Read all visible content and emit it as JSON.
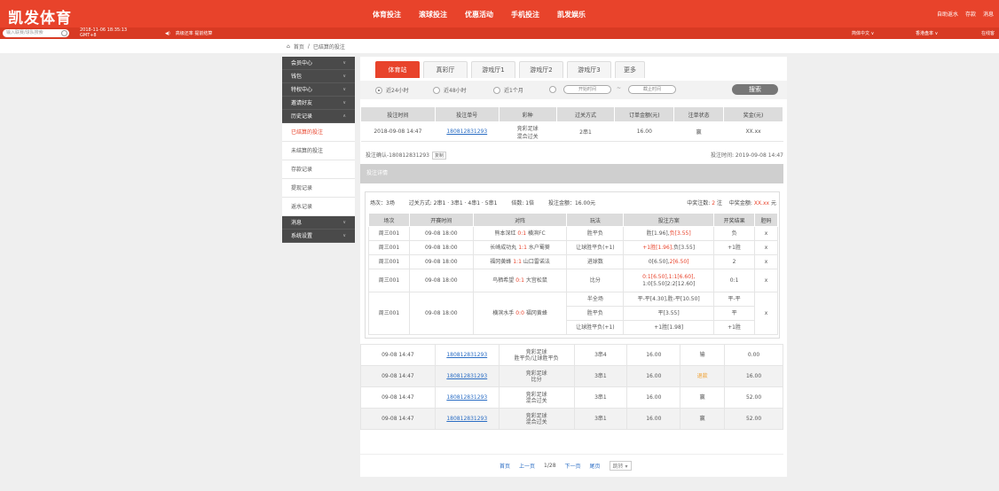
{
  "header": {
    "logo": "凯发体育",
    "nav": [
      "体育投注",
      "滚球投注",
      "优惠活动",
      "手机投注",
      "凯发娱乐"
    ],
    "right": [
      "自助返水",
      "存款",
      "消息"
    ]
  },
  "subbar": {
    "search_placeholder": "输入联赛/球队搜索",
    "datetime_line1": "2018-11-06 18:35:13",
    "datetime_line2": "GMT+8",
    "notice": "高级还率 提前结算",
    "lang": "简体中文 ∨",
    "odds": "香港盘率 ∨",
    "online": "在线客"
  },
  "breadcrumb": {
    "home": "首页",
    "sep": "/",
    "current": "已结算的投注"
  },
  "sidebar": {
    "member": "会员中心",
    "wallet": "钱包",
    "privilege": "特权中心",
    "invite": "邀请好友",
    "history": "历史记录",
    "settled": "已结算的投注",
    "unsettled": "未结算的投注",
    "deposit": "存款记录",
    "withdraw": "提现记录",
    "rebate": "返水记录",
    "message": "消息",
    "settings": "系统设置"
  },
  "tabs": [
    "体育站",
    "真彩厅",
    "游戏厅1",
    "游戏厅2",
    "游戏厅3",
    "更多"
  ],
  "filters": {
    "r1": "近24小时",
    "r2": "近48小时",
    "r3": "近1个月",
    "start": "开始时间",
    "dash": "~",
    "end": "截止时间",
    "search": "搜索"
  },
  "table1": {
    "headers": [
      "投注时间",
      "投注单号",
      "彩种",
      "过关方式",
      "订单金额(元)",
      "注单状态",
      "奖金(元)"
    ],
    "row": {
      "time": "2018-09-08 14:47",
      "order": "180812831293",
      "type1": "竞彩足球",
      "type2": "混合过关",
      "pass": "2串1",
      "amount": "16.00",
      "status": "赢",
      "prize": "XX.xx"
    }
  },
  "betinfo": {
    "id": "投注确认-180812831293",
    "copy": "复制",
    "time": "投注时间: 2019-09-08 14:47"
  },
  "detail": {
    "head": "投注详情",
    "count": "场次：3场",
    "pass": "过关方式: 2串1 · 3串1 · 4串1 · 5串1",
    "multi": "倍数: 1倍",
    "amount": "投注金额：16.00元",
    "win_label": "中奖注数:",
    "win_count": "2",
    "win_unit": "注",
    "prize_label": "中奖金额:",
    "prize_val": "XX.xx",
    "prize_unit": "元",
    "headers": [
      "场次",
      "开赛时间",
      "对阵",
      "玩法",
      "投注方案",
      "开奖结果",
      "胆码"
    ],
    "rows": [
      {
        "no": "周三001",
        "time": "09-08 18:00",
        "home": "熊本深红",
        "score": "0:1",
        "away": "横滨FC",
        "play": "胜平负",
        "plan_a": "胜[1.96],",
        "plan_b": "负[3.55]",
        "result": "负",
        "dan": "x"
      },
      {
        "no": "周三001",
        "time": "09-08 18:00",
        "home": "长崎成功丸",
        "score": "1:1",
        "away": "水户蜀葵",
        "play": "让球胜平负(+1)",
        "plan_a": "+1胜[1.96],",
        "plan_b": "负[3.55]",
        "result": "+1胜",
        "dan": "x"
      },
      {
        "no": "周三001",
        "time": "09-08 18:00",
        "home": "福冈黄蜂",
        "score": "1:1",
        "away": "山口雷诺法",
        "play": "进球数",
        "plan_a": "0[6.50],",
        "plan_b": "2[6.50]",
        "result": "2",
        "dan": "x"
      },
      {
        "no": "周三001",
        "time": "09-08 18:00",
        "home": "鸟栖希望",
        "score": "0:1",
        "away": "大宫松鼠",
        "play": "比分",
        "plan_a": "0:1[6.50],1:1[6.60],",
        "plan_b": "1:0[5.50]2:2[12.60]",
        "result": "0:1",
        "dan": "x"
      },
      {
        "no": "周三001",
        "time": "09-08 18:00",
        "home": "横滨水手",
        "score": "0:0",
        "away": "福冈黄蜂",
        "play_a": "半全场",
        "plan_1": "平-平[4.30],胜-平[10.50]",
        "res_1": "平-平",
        "play_b": "胜平负",
        "plan_2": "平[3.55]",
        "res_2": "平",
        "play_c": "让球胜平负(+1)",
        "plan_3": "+1胜[1.98]",
        "res_3": "+1胜",
        "dan": "x"
      }
    ]
  },
  "table3": [
    {
      "time": "09-08 14:47",
      "order": "180812831293",
      "type1": "竞彩足球",
      "type2": "胜平负/让球胜平负",
      "pass": "3串4",
      "amount": "16.00",
      "status": "输",
      "prize": "0.00"
    },
    {
      "time": "09-08 14:47",
      "order": "180812831293",
      "type1": "竞彩足球",
      "type2": "比分",
      "pass": "3串1",
      "amount": "16.00",
      "status": "退款",
      "prize": "16.00"
    },
    {
      "time": "09-08 14:47",
      "order": "180812831293",
      "type1": "竞彩足球",
      "type2": "混合过关",
      "pass": "3串1",
      "amount": "16.00",
      "status": "赢",
      "prize": "52.00"
    },
    {
      "time": "09-08 14:47",
      "order": "180812831293",
      "type1": "竞彩足球",
      "type2": "混合过关",
      "pass": "3串1",
      "amount": "16.00",
      "status": "赢",
      "prize": "52.00"
    }
  ],
  "pager": {
    "first": "首页",
    "prev": "上一页",
    "page": "1/28",
    "next": "下一页",
    "last": "尾页",
    "jump": "跳转"
  }
}
